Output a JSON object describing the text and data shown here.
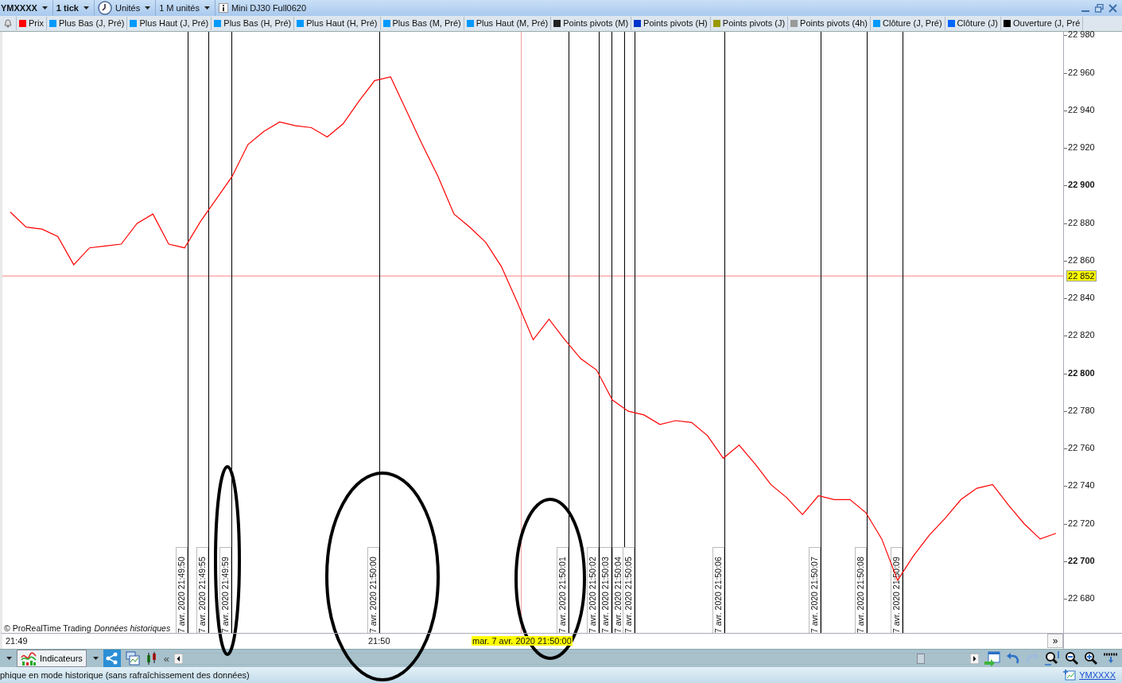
{
  "toolbar": {
    "symbol": "YMXXXX",
    "interval": "1 tick",
    "unit_type": "Unités",
    "units": "1 M unités",
    "instrument": "Mini DJ30 Full0620"
  },
  "legend": [
    {
      "label": "Plus Bas (J, Pré)",
      "color": "#0099ff"
    },
    {
      "label": "Plus Haut (J, Pré)",
      "color": "#0099ff"
    },
    {
      "label": "Plus Bas (H, Pré)",
      "color": "#0099ff"
    },
    {
      "label": "Plus Haut (H, Pré)",
      "color": "#0099ff"
    },
    {
      "label": "Plus Bas (M, Pré)",
      "color": "#0099ff"
    },
    {
      "label": "Plus Haut (M, Pré)",
      "color": "#0099ff"
    },
    {
      "label": "Points pivots (M)",
      "color": "#222222"
    },
    {
      "label": "Points pivots (H)",
      "color": "#0033cc"
    },
    {
      "label": "Points pivots (J)",
      "color": "#999900"
    },
    {
      "label": "Points pivots (4h)",
      "color": "#999999"
    },
    {
      "label": "Clôture (J, Pré)",
      "color": "#0099ff"
    },
    {
      "label": "Clôture (J)",
      "color": "#0066ff"
    },
    {
      "label": "Ouverture (J, Pré",
      "color": "#000000"
    }
  ],
  "chart": {
    "copyright": "© ProRealTime Trading",
    "mode_note": "Données historiques",
    "more_button": "»",
    "time_labels": [
      "21:49",
      "21:50"
    ],
    "cursor_label": "mar. 7 avr. 2020 21:50:00",
    "markers": [
      {
        "text": "7 avr. 2020 21:49:50"
      },
      {
        "text": "7 avr. 2020 21:49:55"
      },
      {
        "text": "7 avr. 2020 21:49:59"
      },
      {
        "text": "7 avr. 2020 21:50:00"
      },
      {
        "text": "7 avr. 2020 21:50:01"
      },
      {
        "text": "7 avr. 2020 21:50:02"
      },
      {
        "text": "7 avr. 2020 21:50:03"
      },
      {
        "text": "7 avr. 2020 21:50:04"
      },
      {
        "text": "7 avr. 2020 21:50:05"
      },
      {
        "text": "7 avr. 2020 21:50:06"
      },
      {
        "text": "7 avr. 2020 21:50:07"
      },
      {
        "text": "7 avr. 2020 21:50:08"
      },
      {
        "text": "7 avr. 2020 21:50:09"
      }
    ],
    "chart_data": {
      "type": "line",
      "ylim": [
        22662,
        22982
      ],
      "grid": true,
      "ref_lines": [
        {
          "axis": "y",
          "value": 22852,
          "label": "22 852",
          "color": "#ff8080"
        }
      ],
      "yticks": [
        {
          "value": 22980,
          "label": "22 980"
        },
        {
          "value": 22960,
          "label": "22 960"
        },
        {
          "value": 22940,
          "label": "22 940"
        },
        {
          "value": 22920,
          "label": "22 920"
        },
        {
          "value": 22900,
          "label": "22 900"
        },
        {
          "value": 22880,
          "label": "22 880"
        },
        {
          "value": 22860,
          "label": "22 860"
        },
        {
          "value": 22840,
          "label": "22 840"
        },
        {
          "value": 22820,
          "label": "22 820"
        },
        {
          "value": 22800,
          "label": "22 800"
        },
        {
          "value": 22780,
          "label": "22 780"
        },
        {
          "value": 22760,
          "label": "22 760"
        },
        {
          "value": 22740,
          "label": "22 740"
        },
        {
          "value": 22720,
          "label": "22 720"
        },
        {
          "value": 22700,
          "label": "22 700"
        },
        {
          "value": 22680,
          "label": "22 680"
        }
      ],
      "categories": [
        null,
        null,
        null,
        null,
        null,
        null,
        null,
        null,
        null,
        null,
        null,
        null,
        null,
        null,
        null,
        null,
        null,
        null,
        null,
        null,
        null,
        null,
        null,
        null,
        null,
        null,
        null,
        null,
        null,
        null,
        null,
        null,
        null,
        null,
        null,
        null,
        null,
        null,
        null,
        null,
        null,
        null,
        null,
        null,
        null,
        null,
        null,
        null,
        null,
        null,
        null,
        null,
        null,
        null,
        null,
        null,
        null,
        null,
        null,
        null,
        null,
        null,
        null,
        null,
        null,
        null,
        null
      ],
      "series": [
        {
          "name": "Prix",
          "color": "#ff0000",
          "values": [
            22886,
            22878,
            22877,
            22873,
            22858,
            22867,
            22868,
            22869,
            22880,
            22885,
            22869,
            22867,
            22881,
            22893,
            22905,
            22922,
            22929,
            22934,
            22932,
            22931,
            22926,
            22933,
            22945,
            22956,
            22958,
            22940,
            22922,
            22905,
            22885,
            22878,
            22870,
            22857,
            22838,
            22818,
            22829,
            22818,
            22808,
            22802,
            22786,
            22780,
            22778,
            22773,
            22775,
            22774,
            22767,
            22755,
            22762,
            22752,
            22741,
            22734,
            22725,
            22735,
            22733,
            22733,
            22726,
            22712,
            22690,
            22703,
            22714,
            22723,
            22733,
            22739,
            22741,
            22730,
            22720,
            22712,
            22715
          ]
        }
      ]
    }
  },
  "bottom_toolbar": {
    "indicators_button": "Indicateurs",
    "collapse": "«"
  },
  "status_bar": {
    "message": "phique en mode historique (sans rafraîchissement des données)",
    "symbol_link": "YMXXXX"
  }
}
